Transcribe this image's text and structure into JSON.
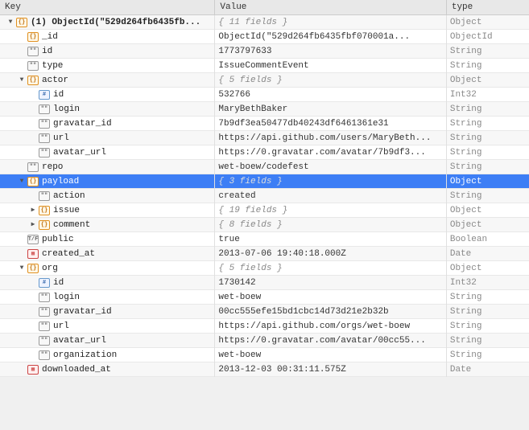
{
  "header": {
    "col_key": "Key",
    "col_value": "Value",
    "col_type": "type"
  },
  "rows": [
    {
      "id": "row-root",
      "indent": 0,
      "toggle": "▼",
      "icon": "obj",
      "key": "(1) ObjectId(\"529d264fb6435fb...",
      "value": "{ 11 fields }",
      "value_style": "gray",
      "type": "Object",
      "selected": false
    },
    {
      "id": "row-_id",
      "indent": 1,
      "toggle": "",
      "icon": "obj",
      "key": "_id",
      "value": "ObjectId(\"529d264fb6435fbf070001a...",
      "value_style": "normal",
      "type": "ObjectId",
      "selected": false
    },
    {
      "id": "row-id",
      "indent": 1,
      "toggle": "",
      "icon": "str",
      "key": "id",
      "value": "1773797633",
      "value_style": "normal",
      "type": "String",
      "selected": false
    },
    {
      "id": "row-type",
      "indent": 1,
      "toggle": "",
      "icon": "str",
      "key": "type",
      "value": "IssueCommentEvent",
      "value_style": "normal",
      "type": "String",
      "selected": false
    },
    {
      "id": "row-actor",
      "indent": 1,
      "toggle": "▼",
      "icon": "obj",
      "key": "actor",
      "value": "{ 5 fields }",
      "value_style": "gray",
      "type": "Object",
      "selected": false
    },
    {
      "id": "row-actor-id",
      "indent": 2,
      "toggle": "",
      "icon": "int",
      "key": "id",
      "value": "532766",
      "value_style": "normal",
      "type": "Int32",
      "selected": false
    },
    {
      "id": "row-actor-login",
      "indent": 2,
      "toggle": "",
      "icon": "str",
      "key": "login",
      "value": "MaryBethBaker",
      "value_style": "normal",
      "type": "String",
      "selected": false
    },
    {
      "id": "row-actor-gravatar_id",
      "indent": 2,
      "toggle": "",
      "icon": "str",
      "key": "gravatar_id",
      "value": "7b9df3ea50477db40243df6461361e31",
      "value_style": "normal",
      "type": "String",
      "selected": false
    },
    {
      "id": "row-actor-url",
      "indent": 2,
      "toggle": "",
      "icon": "str",
      "key": "url",
      "value": "https://api.github.com/users/MaryBeth...",
      "value_style": "normal",
      "type": "String",
      "selected": false
    },
    {
      "id": "row-actor-avatar_url",
      "indent": 2,
      "toggle": "",
      "icon": "str",
      "key": "avatar_url",
      "value": "https://0.gravatar.com/avatar/7b9df3...",
      "value_style": "normal",
      "type": "String",
      "selected": false
    },
    {
      "id": "row-repo",
      "indent": 1,
      "toggle": "",
      "icon": "str",
      "key": "repo",
      "value": "wet-boew/codefest",
      "value_style": "normal",
      "type": "String",
      "selected": false
    },
    {
      "id": "row-payload",
      "indent": 1,
      "toggle": "▼",
      "icon": "obj",
      "key": "payload",
      "value": "{ 3 fields }",
      "value_style": "gray",
      "type": "Object",
      "selected": true
    },
    {
      "id": "row-payload-action",
      "indent": 2,
      "toggle": "",
      "icon": "str",
      "key": "action",
      "value": "created",
      "value_style": "normal",
      "type": "String",
      "selected": false
    },
    {
      "id": "row-payload-issue",
      "indent": 2,
      "toggle": "▶",
      "icon": "obj",
      "key": "issue",
      "value": "{ 19 fields }",
      "value_style": "gray",
      "type": "Object",
      "selected": false
    },
    {
      "id": "row-payload-comment",
      "indent": 2,
      "toggle": "▶",
      "icon": "obj",
      "key": "comment",
      "value": "{ 8 fields }",
      "value_style": "gray",
      "type": "Object",
      "selected": false
    },
    {
      "id": "row-public",
      "indent": 1,
      "toggle": "",
      "icon": "bool",
      "key": "public",
      "value": "true",
      "value_style": "normal",
      "type": "Boolean",
      "selected": false
    },
    {
      "id": "row-created_at",
      "indent": 1,
      "toggle": "",
      "icon": "date",
      "key": "created_at",
      "value": "2013-07-06 19:40:18.000Z",
      "value_style": "normal",
      "type": "Date",
      "selected": false
    },
    {
      "id": "row-org",
      "indent": 1,
      "toggle": "▼",
      "icon": "obj",
      "key": "org",
      "value": "{ 5 fields }",
      "value_style": "gray",
      "type": "Object",
      "selected": false
    },
    {
      "id": "row-org-id",
      "indent": 2,
      "toggle": "",
      "icon": "int",
      "key": "id",
      "value": "1730142",
      "value_style": "normal",
      "type": "Int32",
      "selected": false
    },
    {
      "id": "row-org-login",
      "indent": 2,
      "toggle": "",
      "icon": "str",
      "key": "login",
      "value": "wet-boew",
      "value_style": "normal",
      "type": "String",
      "selected": false
    },
    {
      "id": "row-org-gravatar_id",
      "indent": 2,
      "toggle": "",
      "icon": "str",
      "key": "gravatar_id",
      "value": "00cc555efe15bd1cbc14d73d21e2b32b",
      "value_style": "normal",
      "type": "String",
      "selected": false
    },
    {
      "id": "row-org-url",
      "indent": 2,
      "toggle": "",
      "icon": "str",
      "key": "url",
      "value": "https://api.github.com/orgs/wet-boew",
      "value_style": "normal",
      "type": "String",
      "selected": false
    },
    {
      "id": "row-org-avatar_url",
      "indent": 2,
      "toggle": "",
      "icon": "str",
      "key": "avatar_url",
      "value": "https://0.gravatar.com/avatar/00cc55...",
      "value_style": "normal",
      "type": "String",
      "selected": false
    },
    {
      "id": "row-org-organization",
      "indent": 2,
      "toggle": "",
      "icon": "str",
      "key": "organization",
      "value": "wet-boew",
      "value_style": "normal",
      "type": "String",
      "selected": false
    },
    {
      "id": "row-downloaded_at",
      "indent": 1,
      "toggle": "",
      "icon": "date",
      "key": "downloaded_at",
      "value": "2013-12-03 00:31:11.575Z",
      "value_style": "normal",
      "type": "Date",
      "selected": false
    }
  ],
  "icons": {
    "obj": "{}",
    "str": "\"\"",
    "int": "#",
    "bool": "T/F",
    "date": "📅"
  }
}
